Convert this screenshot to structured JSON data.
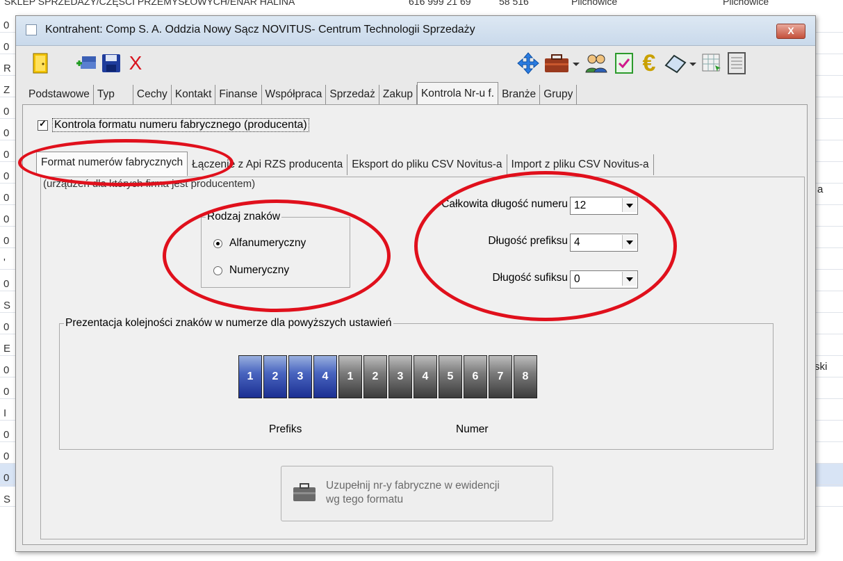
{
  "background": {
    "top_row": [
      "SKLEP SPRZEDAŻY/CZĘŚCI PRZEMYSŁOWYCH/ENAR HALINA",
      "616 999 21 69",
      "58 516",
      "Pilchowice",
      "Pilchowice"
    ],
    "left_chars": [
      "0",
      "0",
      "R",
      "Z",
      "0",
      "0",
      "0",
      "0",
      "0",
      "0",
      "0",
      "'",
      "0",
      "S",
      "0",
      "E",
      "0",
      "0",
      "I",
      "0",
      "0",
      "0",
      "S"
    ],
    "right_fragments": [
      "a",
      "ski"
    ]
  },
  "window": {
    "title": "Kontrahent: Comp S. A. Oddzia Nowy Sącz NOVITUS- Centrum Technologii Sprzedaży",
    "close_label": "X"
  },
  "toolbar": {
    "icons": [
      "exit-door-icon",
      "add-contractor-icon",
      "save-icon",
      "cancel-icon",
      "move-icon",
      "briefcase-icon",
      "people-icon",
      "checklist-icon",
      "euro-icon",
      "eraser-icon",
      "table-icon",
      "document-icon"
    ],
    "cancel_label": "X",
    "euro_label": "€"
  },
  "tabs": [
    "Podstawowe",
    "Typ",
    "Cechy",
    "Kontakt",
    "Finanse",
    "Współpraca",
    "Sprzedaż",
    "Zakup",
    "Kontrola Nr-u f.",
    "Branże",
    "Grupy"
  ],
  "active_tab": "Kontrola Nr-u f.",
  "serial_control": {
    "checkbox_label": "Kontrola formatu numeru fabrycznego (producenta)",
    "checked": true
  },
  "subtabs": [
    "Format numerów fabrycznych",
    "Łączenie z Api RZS producenta",
    "Eksport do pliku CSV Novitus-a",
    "Import z pliku CSV Novitus-a"
  ],
  "active_subtab": "Format numerów fabrycznych",
  "note": "(urządzeń dla których firma jest producentem)",
  "char_type": {
    "title": "Rodzaj znaków",
    "options": [
      "Alfanumeryczny",
      "Numeryczny"
    ],
    "selected": "Alfanumeryczny"
  },
  "lengths": {
    "total_label": "Całkowita długość numeru",
    "total_value": "12",
    "prefix_label": "Długość prefiksu",
    "prefix_value": "4",
    "suffix_label": "Długość sufiksu",
    "suffix_value": "0"
  },
  "presentation": {
    "title": "Prezentacja kolejności znaków w numerze dla powyższych ustawień",
    "prefix_digits": [
      "1",
      "2",
      "3",
      "4"
    ],
    "number_digits": [
      "1",
      "2",
      "3",
      "4",
      "5",
      "6",
      "7",
      "8"
    ],
    "prefix_caption": "Prefiks",
    "number_caption": "Numer"
  },
  "fill_button": {
    "label_line1": "Uzupełnij nr-y fabryczne w ewidencji",
    "label_line2": "wg tego formatu"
  },
  "colors": {
    "prefix_box": "#1b2f92",
    "number_box": "#3c3c3c",
    "annotation": "#e0101c"
  }
}
